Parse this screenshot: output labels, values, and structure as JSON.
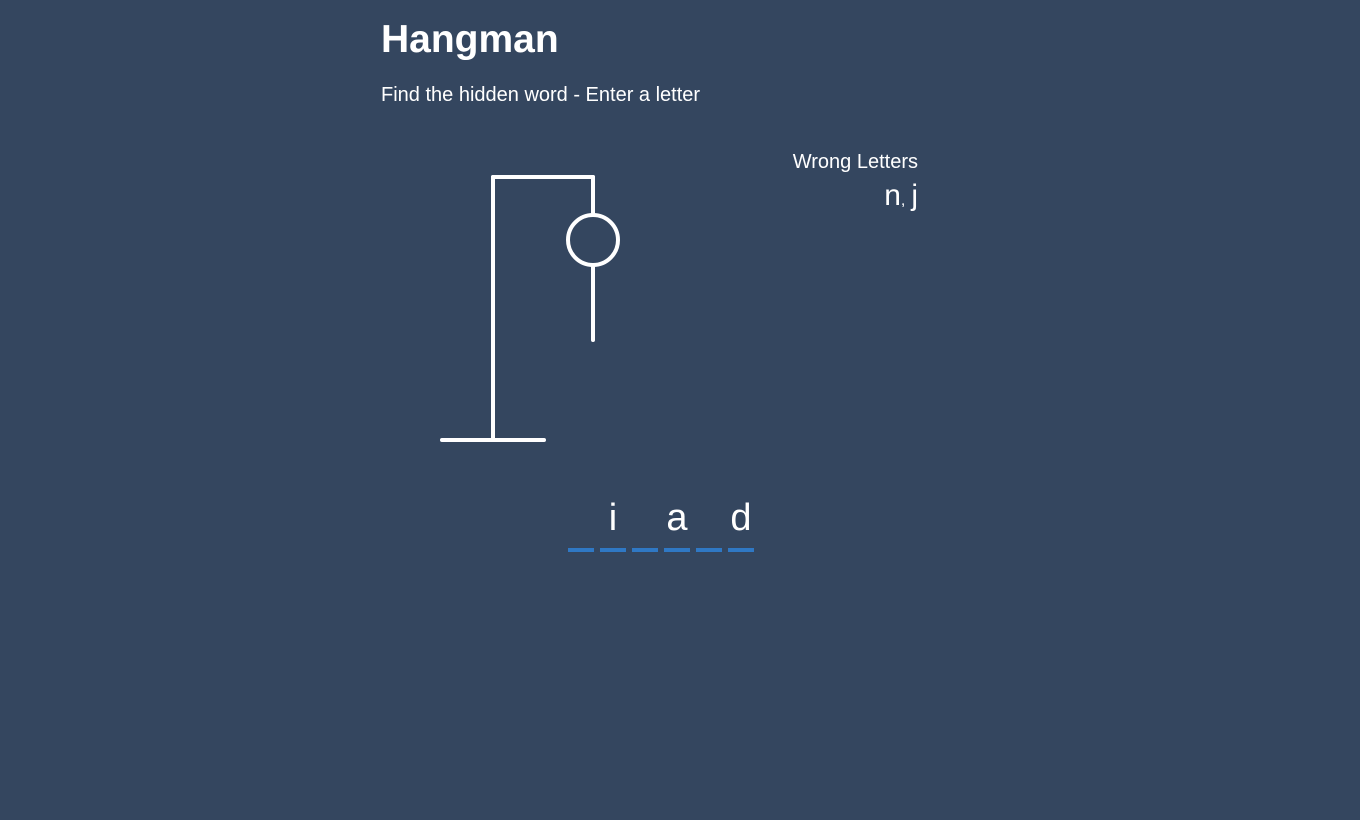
{
  "title": "Hangman",
  "subtitle": "Find the hidden word - Enter a letter",
  "wrong_letters": {
    "label": "Wrong Letters",
    "letters": [
      "n",
      "j"
    ]
  },
  "word_slots": [
    "",
    "i",
    "",
    "a",
    "",
    "d"
  ],
  "hangman_stage": {
    "parts_shown": [
      "head",
      "body"
    ]
  },
  "colors": {
    "background": "#34465f",
    "text": "#ffffff",
    "slot_underline": "#2f78c4"
  }
}
